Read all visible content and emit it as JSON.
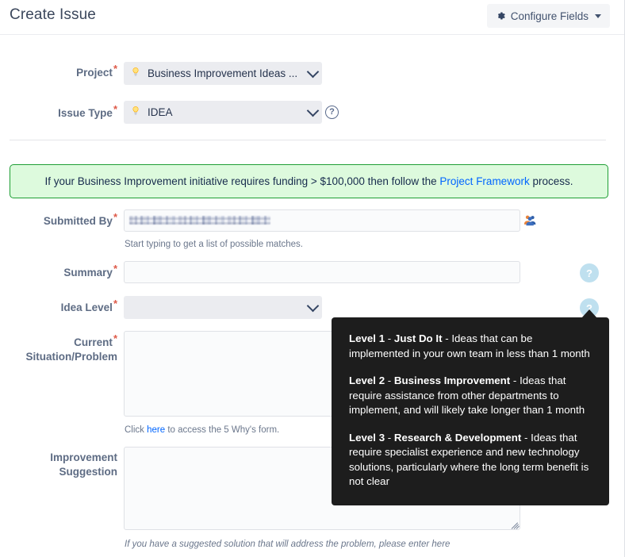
{
  "header": {
    "title": "Create Issue",
    "configure_fields_label": "Configure Fields",
    "gear_icon": "gear-icon",
    "caret_icon": "chevron-down-icon"
  },
  "fields": {
    "project": {
      "label": "Project",
      "required": true,
      "value": "Business Improvement Ideas ...",
      "icon": "lightbulb-icon"
    },
    "issue_type": {
      "label": "Issue Type",
      "required": true,
      "value": "IDEA",
      "icon": "lightbulb-icon",
      "help_icon": "question-circle-icon"
    },
    "submitted_by": {
      "label": "Submitted By",
      "required": true,
      "value": "",
      "hint": "Start typing to get a list of possible matches.",
      "picker_icon": "people-group-icon"
    },
    "summary": {
      "label": "Summary",
      "required": true,
      "value": "",
      "help_icon": "question-mark-badge"
    },
    "idea_level": {
      "label": "Idea Level",
      "required": true,
      "value": "",
      "help_icon": "question-mark-badge"
    },
    "current_situation": {
      "label_line1": "Current",
      "label_line2": "Situation/Problem",
      "required": true,
      "value": "",
      "hint_prefix": "Click ",
      "hint_link": "here",
      "hint_suffix": " to access the 5 Why's form."
    },
    "improvement_suggestion": {
      "label_line1": "Improvement",
      "label_line2": "Suggestion",
      "required": false,
      "value": "",
      "hint": "If you have a suggested solution that will address the problem, please enter here"
    }
  },
  "banner": {
    "text_before_link": "If your Business Improvement initiative requires funding > $100,000 then follow the ",
    "link_text": "Project Framework",
    "text_after_link": " process."
  },
  "tooltip": {
    "levels": [
      {
        "name": "Level 1",
        "dash1": " - ",
        "title": "Just Do It",
        "dash2": " - ",
        "description": "Ideas that can be implemented in your own team in less than 1 month"
      },
      {
        "name": "Level 2",
        "dash1": " - ",
        "title": "Business Improvement",
        "dash2": " - ",
        "description": "Ideas that require assistance from other departments to implement, and will likely take longer than 1 month"
      },
      {
        "name": "Level 3",
        "dash1": " - ",
        "title": "Research & Development",
        "dash2": " - ",
        "description": "Ideas that require specialist experience and new technology solutions, particularly where the long term benefit is not clear"
      }
    ]
  },
  "colors": {
    "banner_bg": "#ddfadd",
    "banner_border": "#1e9e34",
    "link": "#0065ff",
    "required_star": "#de5a49",
    "label": "#5e6c84",
    "select_bg": "#ebecf0",
    "tooltip_bg": "#1d1d1d",
    "help_circle": "#bfe0ef"
  },
  "help_glyph": "?"
}
